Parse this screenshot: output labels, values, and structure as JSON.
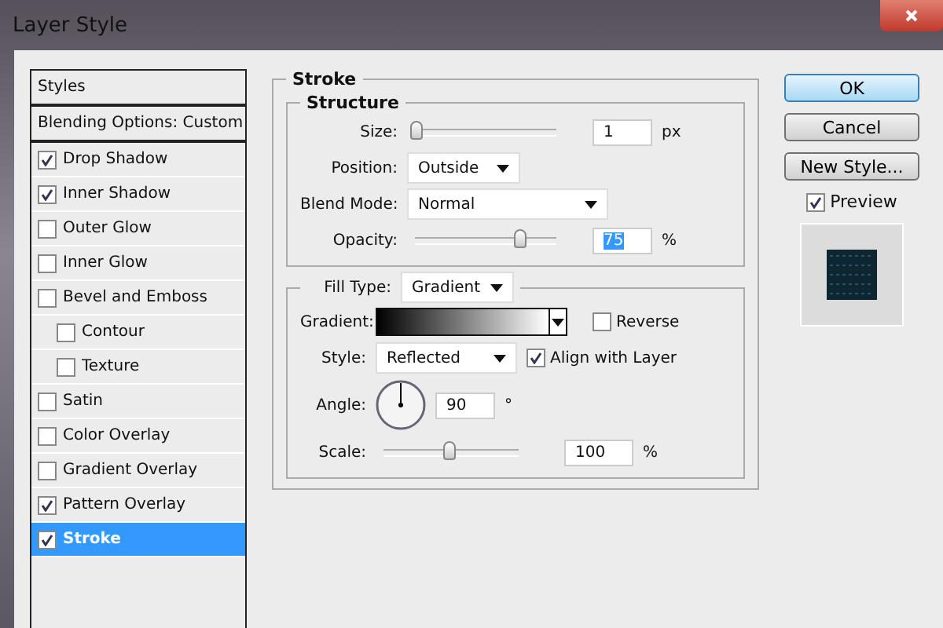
{
  "window": {
    "title": "Layer Style"
  },
  "styles": [
    {
      "label": "Styles",
      "kind": "header",
      "selected": false
    },
    {
      "label": "Blending Options: Custom",
      "kind": "header",
      "selected": false
    },
    {
      "label": "Drop Shadow",
      "kind": "check",
      "checked": true,
      "selected": false
    },
    {
      "label": "Inner Shadow",
      "kind": "check",
      "checked": true,
      "selected": false
    },
    {
      "label": "Outer Glow",
      "kind": "check",
      "checked": false,
      "selected": false
    },
    {
      "label": "Inner Glow",
      "kind": "check",
      "checked": false,
      "selected": false
    },
    {
      "label": "Bevel and Emboss",
      "kind": "check",
      "checked": false,
      "selected": false,
      "children": [
        {
          "label": "Contour",
          "kind": "check",
          "checked": false,
          "selected": false
        },
        {
          "label": "Texture",
          "kind": "check",
          "checked": false,
          "selected": false
        }
      ]
    },
    {
      "label": "Satin",
      "kind": "check",
      "checked": false,
      "selected": false
    },
    {
      "label": "Color Overlay",
      "kind": "check",
      "checked": false,
      "selected": false
    },
    {
      "label": "Gradient Overlay",
      "kind": "check",
      "checked": false,
      "selected": false
    },
    {
      "label": "Pattern Overlay",
      "kind": "check",
      "checked": true,
      "selected": false
    },
    {
      "label": "Stroke",
      "kind": "check",
      "checked": true,
      "selected": true
    }
  ],
  "stroke": {
    "title": "Stroke",
    "structure": {
      "title": "Structure",
      "size": {
        "label": "Size:",
        "level": 0.02,
        "value": "1",
        "unit": "px"
      },
      "position": {
        "label": "Position:",
        "value": "Outside"
      },
      "blend_mode": {
        "label": "Blend Mode:",
        "value": "Normal"
      },
      "opacity": {
        "label": "Opacity:",
        "level": 0.75,
        "value": "75",
        "unit": "%"
      }
    },
    "fill": {
      "label": "Fill Type:",
      "value": "Gradient",
      "gradient": {
        "label": "Gradient:"
      },
      "reverse": {
        "label": "Reverse",
        "checked": false
      },
      "style": {
        "label": "Style:",
        "value": "Reflected"
      },
      "align": {
        "label": "Align with Layer",
        "checked": true
      },
      "angle": {
        "label": "Angle:",
        "value": "90",
        "unit": "°"
      },
      "scale": {
        "label": "Scale:",
        "level": 0.5,
        "value": "100",
        "unit": "%"
      }
    }
  },
  "buttons": [
    {
      "label": "OK",
      "kind": "default"
    },
    {
      "label": "Cancel",
      "kind": "normal"
    },
    {
      "label": "New Style...",
      "kind": "normal"
    }
  ],
  "preview": {
    "label": "Preview",
    "checked": true
  }
}
